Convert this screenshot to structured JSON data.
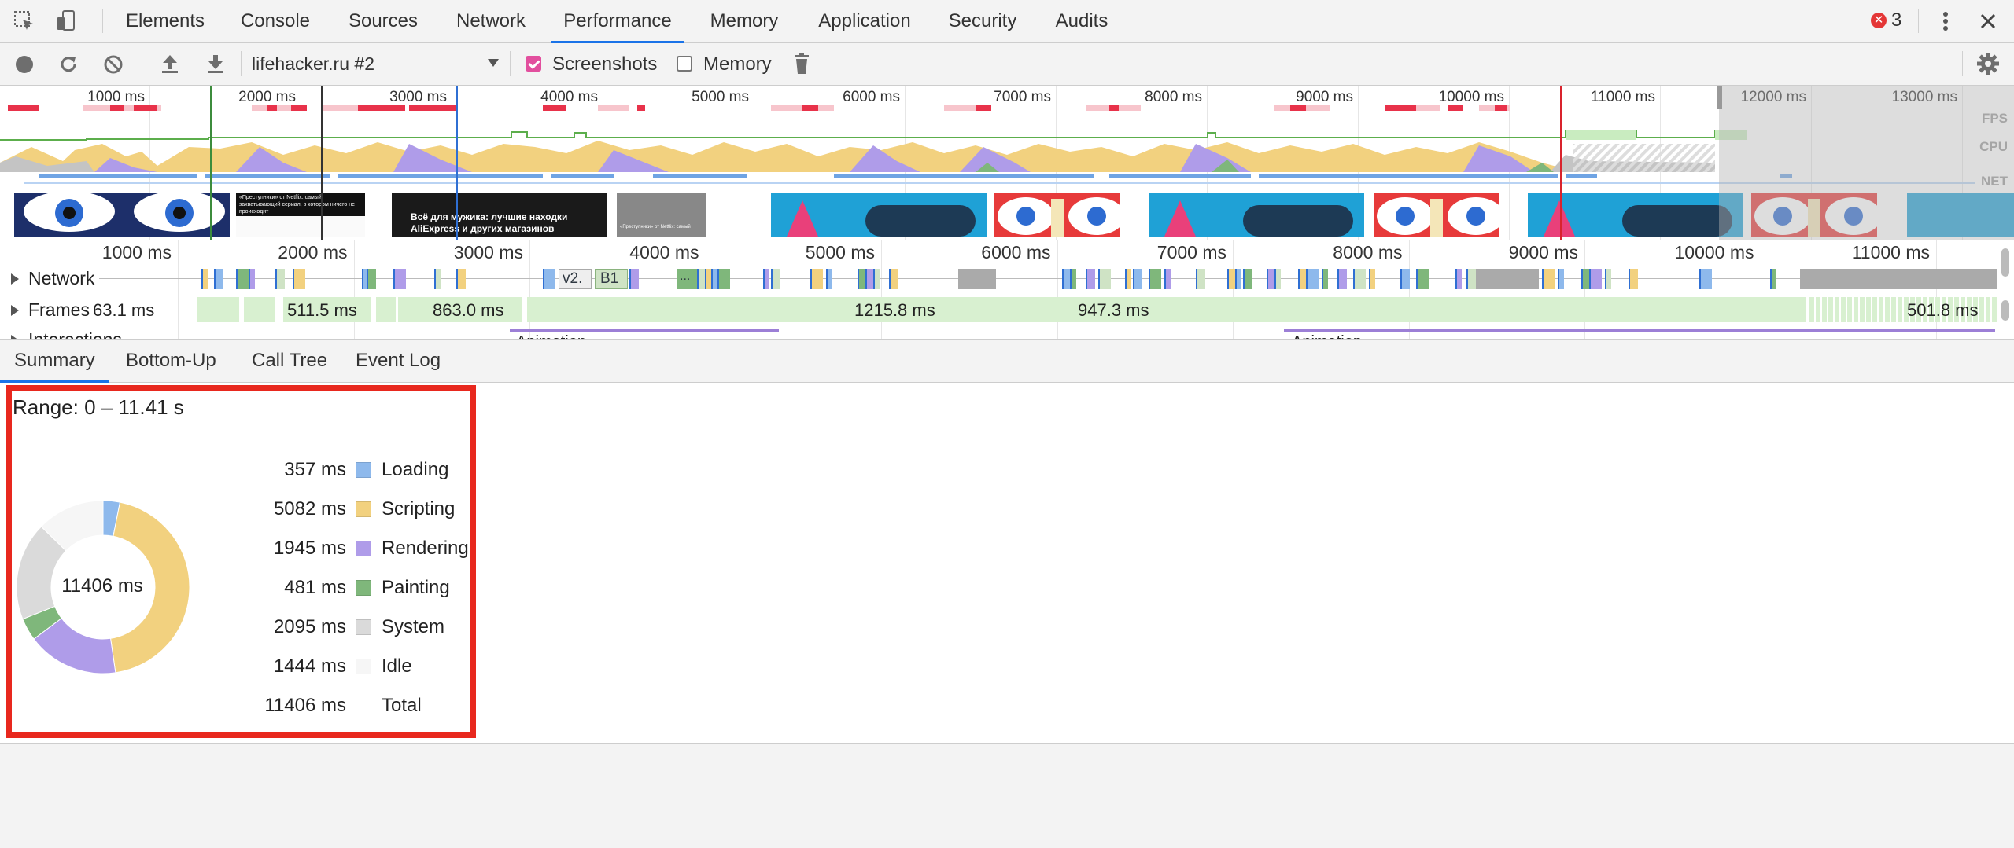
{
  "tabs": [
    "Elements",
    "Console",
    "Sources",
    "Network",
    "Performance",
    "Memory",
    "Application",
    "Security",
    "Audits"
  ],
  "active_tab": "Performance",
  "error_count": "3",
  "toolbar": {
    "profile_name": "lifehacker.ru #2",
    "screenshots_label": "Screenshots",
    "screenshots_checked": true,
    "memory_label": "Memory",
    "memory_checked": false
  },
  "overview": {
    "ticks": [
      "1000 ms",
      "2000 ms",
      "3000 ms",
      "4000 ms",
      "5000 ms",
      "6000 ms",
      "7000 ms",
      "8000 ms",
      "9000 ms",
      "10000 ms",
      "11000 ms",
      "12000 ms",
      "13000 ms"
    ],
    "lane_fps": "FPS",
    "lane_cpu": "CPU",
    "lane_net": "NET",
    "screenshot_captions": [
      "«Преступники» от Netflix: самый захватывающий сериал, в котором ничего не происходит",
      "Всё для мужика: лучшие находки AliExpress и других магазинов",
      "«Преступники» от Netflix: самый"
    ]
  },
  "timeline": {
    "ticks": [
      "1000 ms",
      "2000 ms",
      "3000 ms",
      "4000 ms",
      "5000 ms",
      "6000 ms",
      "7000 ms",
      "8000 ms",
      "9000 ms",
      "10000 ms",
      "11000 ms"
    ],
    "network_label": "Network",
    "frames_label": "Frames",
    "interactions_label": "Interactions",
    "animation_label": "Animation",
    "network_items": [
      "v2.",
      "B1",
      "..."
    ],
    "frame_times": [
      "63.1 ms",
      "511.5 ms",
      "863.0 ms",
      "1215.8 ms",
      "947.3 ms",
      "501.8 ms"
    ]
  },
  "bottom_tabs": [
    "Summary",
    "Bottom-Up",
    "Call Tree",
    "Event Log"
  ],
  "active_bottom_tab": "Summary",
  "summary": {
    "range": "Range: 0 – 11.41 s",
    "total_center": "11406 ms",
    "items": [
      {
        "value": "357 ms",
        "label": "Loading",
        "ms": 357,
        "color": "#8eb9ec"
      },
      {
        "value": "5082 ms",
        "label": "Scripting",
        "ms": 5082,
        "color": "#f2d17f"
      },
      {
        "value": "1945 ms",
        "label": "Rendering",
        "ms": 1945,
        "color": "#af9ce9"
      },
      {
        "value": "481 ms",
        "label": "Painting",
        "ms": 481,
        "color": "#7fb77b"
      },
      {
        "value": "2095 ms",
        "label": "System",
        "ms": 2095,
        "color": "#dadada"
      },
      {
        "value": "1444 ms",
        "label": "Idle",
        "ms": 1444,
        "color": "#f6f6f6"
      },
      {
        "value": "11406 ms",
        "label": "Total"
      }
    ]
  }
}
